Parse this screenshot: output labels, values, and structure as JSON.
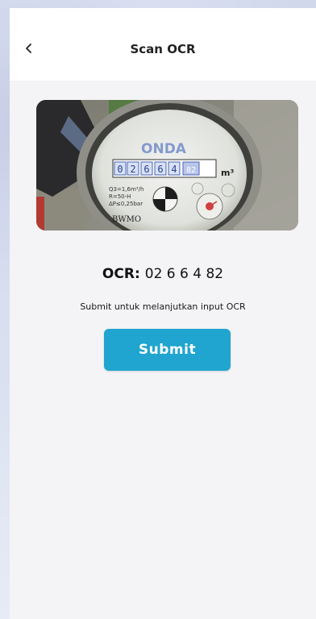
{
  "header": {
    "title": "Scan OCR",
    "back_icon": "chevron-left-icon"
  },
  "photo": {
    "brand_text": "ONDA",
    "unit_text": "m³",
    "spec_lines": [
      "Q3=1,6m³/h",
      "R=50-H",
      "ΔP≤0,25bar"
    ],
    "maker_text": "BWMO",
    "detected_digits": [
      "0",
      "2",
      "6",
      "6",
      "4",
      "82"
    ]
  },
  "result": {
    "label": "OCR:",
    "value": "02 6 6 4 82"
  },
  "instruction": "Submit untuk melanjutkan input OCR",
  "submit_label": "Submit",
  "colors": {
    "accent": "#1fa5cf",
    "header_bg": "#ffffff",
    "page_bg": "#f4f4f6"
  }
}
